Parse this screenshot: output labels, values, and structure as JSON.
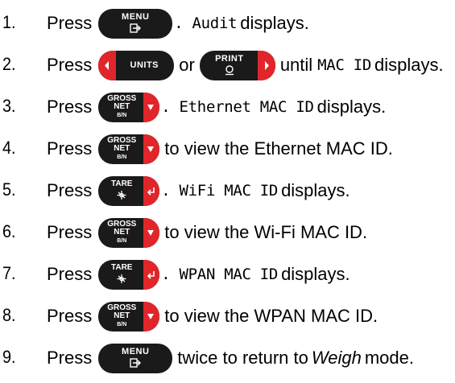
{
  "press": "Press",
  "keys": {
    "menu": "MENU",
    "units": "UNITS",
    "print": "PRINT",
    "gross": "GROSS",
    "net": "NET",
    "bn": "B/N",
    "tare": "TARE"
  },
  "steps": [
    {
      "num": "1.",
      "mono": ". Audit",
      "text": "displays."
    },
    {
      "num": "2.",
      "or": "or",
      "until": "until",
      "mono": "MAC ID",
      "text": "displays."
    },
    {
      "num": "3.",
      "mono": ". Ethernet MAC ID",
      "text": "displays."
    },
    {
      "num": "4.",
      "text": "to view the Ethernet MAC ID."
    },
    {
      "num": "5.",
      "mono": ". WiFi MAC ID",
      "text": "displays."
    },
    {
      "num": "6.",
      "text": "to view the Wi-Fi MAC ID."
    },
    {
      "num": "7.",
      "mono": ". WPAN MAC ID",
      "text": "displays."
    },
    {
      "num": "8.",
      "text": "to view the WPAN MAC ID."
    },
    {
      "num": "9.",
      "pre": "twice to return to",
      "ital": "Weigh",
      "post": "mode."
    }
  ]
}
